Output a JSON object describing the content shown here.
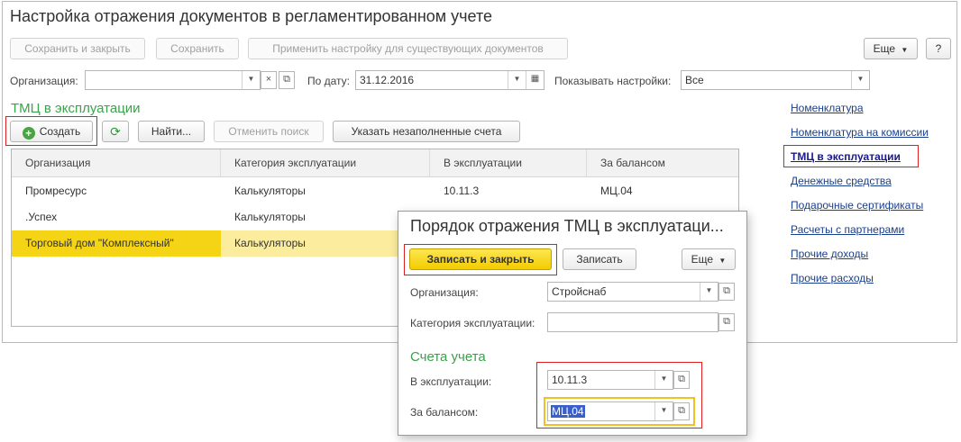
{
  "window": {
    "title": "Настройка отражения документов в регламентированном учете"
  },
  "toolbar": {
    "save_close": "Сохранить и закрыть",
    "save": "Сохранить",
    "apply_existing": "Применить настройку для существующих документов",
    "more": "Еще",
    "help": "?"
  },
  "filters": {
    "org_label": "Организация:",
    "org_value": "",
    "date_label": "По дату:",
    "date_value": "31.12.2016",
    "show_label": "Показывать настройки:",
    "show_value": "Все"
  },
  "section": {
    "title": "ТМЦ в эксплуатации",
    "create": "Создать",
    "find": "Найти...",
    "cancel_search": "Отменить поиск",
    "show_unfilled": "Указать незаполненные счета"
  },
  "table": {
    "columns": [
      "Организация",
      "Категория эксплуатации",
      "В эксплуатации",
      "За балансом"
    ],
    "rows": [
      [
        "Промресурс",
        "Калькуляторы",
        "10.11.3",
        "МЦ.04"
      ],
      [
        ".Успех",
        "Калькуляторы",
        "",
        ""
      ],
      [
        "Торговый дом \"Комплексный\"",
        "Калькуляторы",
        "",
        ""
      ]
    ]
  },
  "nav_links": [
    "Номенклатура",
    "Номенклатура на комиссии",
    "ТМЦ в эксплуатации",
    "Денежные средства",
    "Подарочные сертификаты",
    "Расчеты с партнерами",
    "Прочие доходы",
    "Прочие расходы"
  ],
  "dialog": {
    "title": "Порядок отражения ТМЦ в эксплуатаци...",
    "write_close": "Записать и закрыть",
    "write": "Записать",
    "more": "Еще",
    "org_label": "Организация:",
    "org_value": "Стройснаб",
    "category_label": "Категория эксплуатации:",
    "category_value": "",
    "accounts_title": "Счета учета",
    "in_use_label": "В эксплуатации:",
    "in_use_value": "10.11.3",
    "off_balance_label": "За балансом:",
    "off_balance_value": "МЦ.04"
  },
  "colors": {
    "accent_green": "#3aa24b",
    "selection_yellow": "#f5d416",
    "highlight_red": "#e02020",
    "link_blue": "#1a3f8c"
  }
}
